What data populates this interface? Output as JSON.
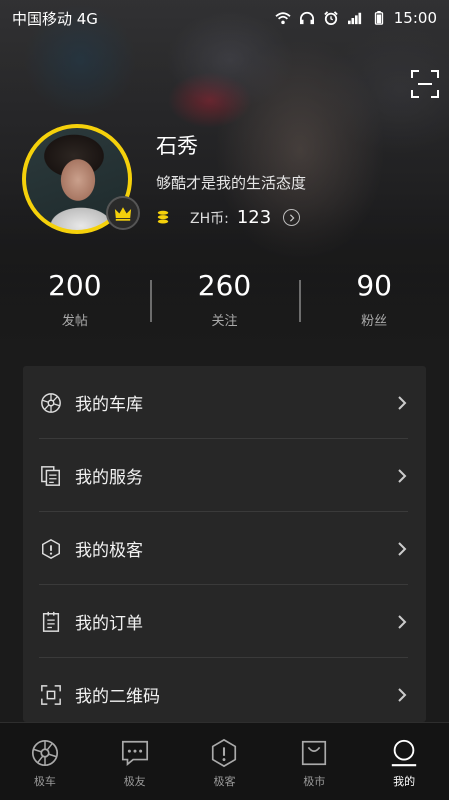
{
  "status_bar": {
    "carrier": "中国移动 4G",
    "time": "15:00",
    "icons": [
      "wifi-icon",
      "headphones-icon",
      "alarm-icon",
      "signal-icon",
      "battery-icon"
    ]
  },
  "profile": {
    "name": "石秀",
    "bio": "够酷才是我的生活态度",
    "coin_label": "ZH币:",
    "coin_value": "123",
    "accent_color": "#f5d10b"
  },
  "stats": [
    {
      "value": "200",
      "label": "发帖"
    },
    {
      "value": "260",
      "label": "关注"
    },
    {
      "value": "90",
      "label": "粉丝"
    }
  ],
  "menu": [
    {
      "label": "我的车库",
      "icon": "wheel-icon"
    },
    {
      "label": "我的服务",
      "icon": "documents-icon"
    },
    {
      "label": "我的极客",
      "icon": "hexagon-info-icon"
    },
    {
      "label": "我的订单",
      "icon": "clipboard-icon"
    },
    {
      "label": "我的二维码",
      "icon": "qr-frame-icon"
    }
  ],
  "tabs": [
    {
      "label": "极车",
      "icon": "wheel-icon",
      "active": false
    },
    {
      "label": "极友",
      "icon": "chat-bubble-icon",
      "active": false
    },
    {
      "label": "极客",
      "icon": "hexagon-info-icon",
      "active": false
    },
    {
      "label": "极市",
      "icon": "shopping-bag-icon",
      "active": false
    },
    {
      "label": "我的",
      "icon": "person-icon",
      "active": true
    }
  ]
}
